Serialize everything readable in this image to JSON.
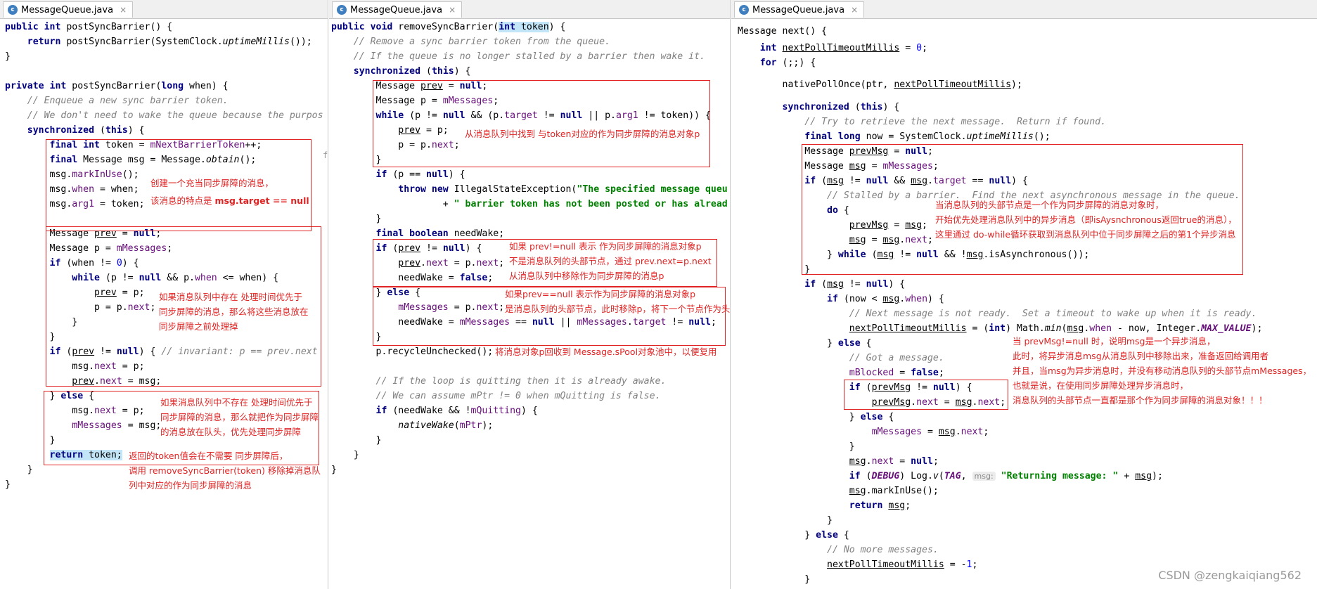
{
  "tabs": {
    "left": "MessageQueue.java",
    "middle": "MessageQueue.java",
    "right": "MessageQueue.java"
  },
  "left_pane": {
    "lines": [
      "public int postSyncBarrier() {",
      "    return postSyncBarrier(SystemClock.uptimeMillis());",
      "}",
      "",
      "private int postSyncBarrier(long when) {",
      "    // Enqueue a new sync barrier token.",
      "    // We don't need to wake the queue because the purpos",
      "    synchronized (this) {",
      "        final int token = mNextBarrierToken++;",
      "        final Message msg = Message.obtain();",
      "        msg.markInUse();",
      "        msg.when = when;",
      "        msg.arg1 = token;",
      "",
      "        Message prev = null;",
      "        Message p = mMessages;",
      "        if (when != 0) {",
      "            while (p != null && p.when <= when) {",
      "                prev = p;",
      "                p = p.next;",
      "            }",
      "        }",
      "        if (prev != null) { // invariant: p == prev.next",
      "            msg.next = p;",
      "            prev.next = msg;",
      "        } else {",
      "            msg.next = p;",
      "            mMessages = msg;",
      "        }",
      "        return token;",
      "    }",
      "}"
    ],
    "notes": {
      "n1a": "创建一个充当同步屏障的消息，",
      "n1b": "该消息的特点是 ",
      "n1c": "msg.target == null",
      "n2": "如果消息队列中存在 处理时间优先于\n同步屏障的消息，那么将这些消息放在\n同步屏障之前处理掉",
      "n3": "如果消息队列中不存在 处理时间优先于\n同步屏障的消息，那么就把作为同步屏障\n的消息放在队头，优先处理同步屏障",
      "n4": "返回的token值会在不需要 同步屏障后，\n调用 removeSyncBarrier(token) 移除掉消息队\n列中对应的作为同步屏障的消息"
    }
  },
  "middle_pane": {
    "lines": [
      "public void removeSyncBarrier(int token) {",
      "    // Remove a sync barrier token from the queue.",
      "    // If the queue is no longer stalled by a barrier then wake it.",
      "    synchronized (this) {",
      "        Message prev = null;",
      "        Message p = mMessages;",
      "        while (p != null && (p.target != null || p.arg1 != token)) {",
      "            prev = p;",
      "            p = p.next;",
      "        }",
      "        if (p == null) {",
      "            throw new IllegalStateException(\"The specified message queu",
      "                    + \" barrier token has not been posted or has alread",
      "        }",
      "        final boolean needWake;",
      "        if (prev != null) {",
      "            prev.next = p.next;",
      "            needWake = false;",
      "        } else {",
      "            mMessages = p.next;",
      "            needWake = mMessages == null || mMessages.target != null;",
      "        }",
      "        p.recycleUnchecked();",
      "",
      "        // If the loop is quitting then it is already awake.",
      "        // We can assume mPtr != 0 when mQuitting is false.",
      "        if (needWake && !mQuitting) {",
      "            nativeWake(mPtr);",
      "        }",
      "    }",
      "}"
    ],
    "notes": {
      "n1": "从消息队列中找到 与token对应的作为同步屏障的消息对象p",
      "n2": "如果 prev!=null 表示 作为同步屏障的消息对象p\n不是消息队列的头部节点，通过 prev.next=p.next\n从消息队列中移除作为同步屏障的消息p",
      "n3": "如果prev==null 表示作为同步屏障的消息对象p\n是消息队列的头部节点，此时移除p，将下一个节点作为头部节点",
      "n4": "将消息对象p回收到 Message.sPool对象池中，以便复用"
    }
  },
  "right_pane": {
    "lines": [
      "Message next() {",
      "    int nextPollTimeoutMillis = 0;",
      "    for (;;) {",
      "",
      "        nativePollOnce(ptr, nextPollTimeoutMillis);",
      "",
      "        synchronized (this) {",
      "            // Try to retrieve the next message.  Return if found.",
      "            final long now = SystemClock.uptimeMillis();",
      "            Message prevMsg = null;",
      "            Message msg = mMessages;",
      "            if (msg != null && msg.target == null) {",
      "                // Stalled by a barrier.  Find the next asynchronous message in the queue.",
      "                do {",
      "                    prevMsg = msg;",
      "                    msg = msg.next;",
      "                } while (msg != null && !msg.isAsynchronous());",
      "            }",
      "            if (msg != null) {",
      "                if (now < msg.when) {",
      "                    // Next message is not ready.  Set a timeout to wake up when it is ready.",
      "                    nextPollTimeoutMillis = (int) Math.min(msg.when - now, Integer.MAX_VALUE);",
      "                } else {",
      "                    // Got a message.",
      "                    mBlocked = false;",
      "                    if (prevMsg != null) {",
      "                        prevMsg.next = msg.next;",
      "                    } else {",
      "                        mMessages = msg.next;",
      "                    }",
      "                    msg.next = null;",
      "                    if (DEBUG) Log.v(TAG, msg: \"Returning message: \" + msg);",
      "                    msg.markInUse();",
      "                    return msg;",
      "                }",
      "            } else {",
      "                // No more messages.",
      "                nextPollTimeoutMillis = -1;",
      "            }"
    ],
    "notes": {
      "n1": "当消息队列的头部节点是一个作为同步屏障的消息对象时，\n开始优先处理消息队列中的异步消息（即isAysnchronous返回true的消息），\n这里通过 do-while循环获取到消息队列中位于同步屏障之后的第1个异步消息",
      "n2": "当 prevMsg!=null 时，说明msg是一个异步消息，\n此时，将异步消息msg从消息队列中移除出来，准备返回给调用者\n并且，当msg为异步消息时，并没有移动消息队列的头部节点mMessages，\n也就是说，在使用同步屏障处理异步消息时，\n消息队列的头部节点一直都是那个作为同步屏障的消息对象！！！"
    }
  },
  "watermark": "CSDN @zengkaiqiang562"
}
